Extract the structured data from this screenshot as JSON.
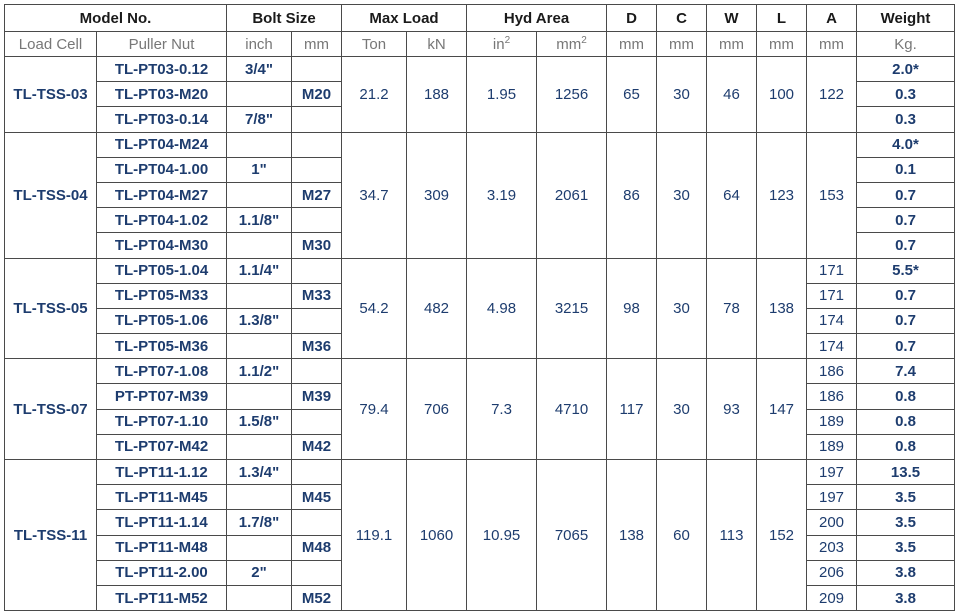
{
  "header": {
    "model_no": "Model No.",
    "bolt_size": "Bolt Size",
    "max_load": "Max Load",
    "hyd_area": "Hyd Area",
    "d": "D",
    "c": "C",
    "w": "W",
    "l": "L",
    "a": "A",
    "weight": "Weight"
  },
  "subheader": {
    "load_cell": "Load Cell",
    "puller_nut": "Puller Nut",
    "inch": "inch",
    "mm": "mm",
    "ton": "Ton",
    "kn": "kN",
    "in2": "in",
    "in2_sup": "2",
    "mm2": "mm",
    "mm2_sup": "2",
    "d_unit": "mm",
    "c_unit": "mm",
    "w_unit": "mm",
    "l_unit": "mm",
    "a_unit": "mm",
    "kg": "Kg."
  },
  "groups": [
    {
      "load_cell": "TL-TSS-03",
      "ton": "21.2",
      "kn": "188",
      "in2": "1.95",
      "mm2": "1256",
      "d": "65",
      "c": "30",
      "w": "46",
      "l": "100",
      "a_merged": true,
      "rows": [
        {
          "nut": "TL-PT03-0.12",
          "inch": "3/4\"",
          "mm": "",
          "a": "122",
          "weight": "2.0*"
        },
        {
          "nut": "TL-PT03-M20",
          "inch": "",
          "mm": "M20",
          "a": "",
          "weight": "0.3"
        },
        {
          "nut": "TL-PT03-0.14",
          "inch": "7/8\"",
          "mm": "",
          "a": "",
          "weight": "0.3"
        }
      ]
    },
    {
      "load_cell": "TL-TSS-04",
      "ton": "34.7",
      "kn": "309",
      "in2": "3.19",
      "mm2": "2061",
      "d": "86",
      "c": "30",
      "w": "64",
      "l": "123",
      "a_merged": true,
      "rows": [
        {
          "nut": "TL-PT04-M24",
          "inch": "",
          "mm": "",
          "a": "153",
          "weight": "4.0*"
        },
        {
          "nut": "TL-PT04-1.00",
          "inch": "1\"",
          "mm": "",
          "a": "",
          "weight": "0.1"
        },
        {
          "nut": "TL-PT04-M27",
          "inch": "",
          "mm": "M27",
          "a": "",
          "weight": "0.7"
        },
        {
          "nut": "TL-PT04-1.02",
          "inch": "1.1/8\"",
          "mm": "",
          "a": "",
          "weight": "0.7"
        },
        {
          "nut": "TL-PT04-M30",
          "inch": "",
          "mm": "M30",
          "a": "",
          "weight": "0.7"
        }
      ]
    },
    {
      "load_cell": "TL-TSS-05",
      "ton": "54.2",
      "kn": "482",
      "in2": "4.98",
      "mm2": "3215",
      "d": "98",
      "c": "30",
      "w": "78",
      "l": "138",
      "a_merged": false,
      "rows": [
        {
          "nut": "TL-PT05-1.04",
          "inch": "1.1/4\"",
          "mm": "",
          "a": "171",
          "weight": "5.5*"
        },
        {
          "nut": "TL-PT05-M33",
          "inch": "",
          "mm": "M33",
          "a": "171",
          "weight": "0.7"
        },
        {
          "nut": "TL-PT05-1.06",
          "inch": "1.3/8\"",
          "mm": "",
          "a": "174",
          "weight": "0.7"
        },
        {
          "nut": "TL-PT05-M36",
          "inch": "",
          "mm": "M36",
          "a": "174",
          "weight": "0.7"
        }
      ]
    },
    {
      "load_cell": "TL-TSS-07",
      "ton": "79.4",
      "kn": "706",
      "in2": "7.3",
      "mm2": "4710",
      "d": "117",
      "c": "30",
      "w": "93",
      "l": "147",
      "a_merged": false,
      "rows": [
        {
          "nut": "TL-PT07-1.08",
          "inch": "1.1/2\"",
          "mm": "",
          "a": "186",
          "weight": "7.4"
        },
        {
          "nut": "PT-PT07-M39",
          "inch": "",
          "mm": "M39",
          "a": "186",
          "weight": "0.8"
        },
        {
          "nut": "TL-PT07-1.10",
          "inch": "1.5/8\"",
          "mm": "",
          "a": "189",
          "weight": "0.8"
        },
        {
          "nut": "TL-PT07-M42",
          "inch": "",
          "mm": "M42",
          "a": "189",
          "weight": "0.8"
        }
      ]
    },
    {
      "load_cell": "TL-TSS-11",
      "ton": "119.1",
      "kn": "1060",
      "in2": "10.95",
      "mm2": "7065",
      "d": "138",
      "c": "60",
      "w": "113",
      "l": "152",
      "a_merged": false,
      "rows": [
        {
          "nut": "TL-PT11-1.12",
          "inch": "1.3/4\"",
          "mm": "",
          "a": "197",
          "weight": "13.5"
        },
        {
          "nut": "TL-PT11-M45",
          "inch": "",
          "mm": "M45",
          "a": "197",
          "weight": "3.5"
        },
        {
          "nut": "TL-PT11-1.14",
          "inch": "1.7/8\"",
          "mm": "",
          "a": "200",
          "weight": "3.5"
        },
        {
          "nut": "TL-PT11-M48",
          "inch": "",
          "mm": "M48",
          "a": "203",
          "weight": "3.5"
        },
        {
          "nut": "TL-PT11-2.00",
          "inch": "2\"",
          "mm": "",
          "a": "206",
          "weight": "3.8"
        },
        {
          "nut": "TL-PT11-M52",
          "inch": "",
          "mm": "M52",
          "a": "209",
          "weight": "3.8"
        }
      ]
    }
  ]
}
